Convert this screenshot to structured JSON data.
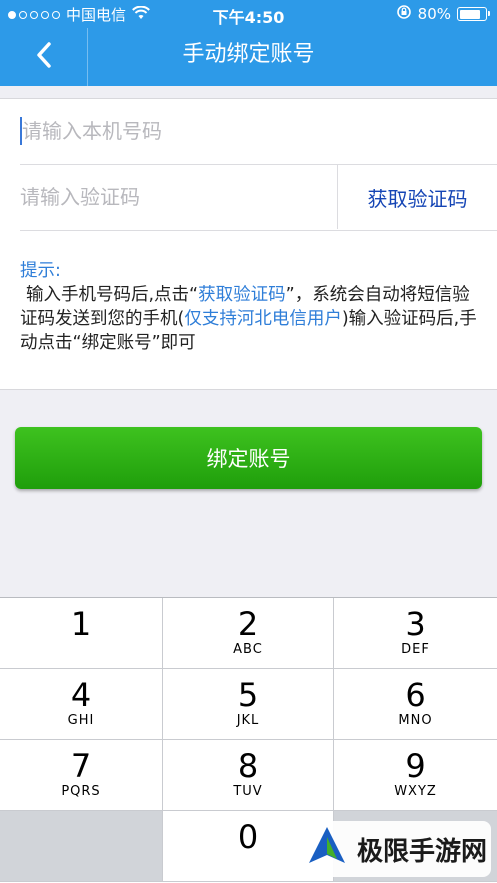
{
  "status_bar": {
    "carrier": "中国电信",
    "time": "下午4:50",
    "battery": "80%",
    "battery_level": 0.8,
    "signal_bars_filled": 1,
    "signal_bars_total": 5
  },
  "nav": {
    "back_icon": "chevron-left-icon",
    "title": "手动绑定账号"
  },
  "form": {
    "phone_placeholder": "请输入本机号码",
    "phone_value": "",
    "code_placeholder": "请输入验证码",
    "code_value": "",
    "get_code_label": "获取验证码"
  },
  "hint": {
    "label": "提示:",
    "part1": "输入手机号码后,点击“",
    "link1": "获取验证码",
    "part2": "”，系统会自动将短信验证码发送到您的手机(",
    "link2": "仅支持河北电信用户",
    "part3": ")输入验证码后,手动点击“绑定账号”即可"
  },
  "bind_button": {
    "label": "绑定账号"
  },
  "keypad": {
    "keys": [
      {
        "num": "1",
        "letters": ""
      },
      {
        "num": "2",
        "letters": "ABC"
      },
      {
        "num": "3",
        "letters": "DEF"
      },
      {
        "num": "4",
        "letters": "GHI"
      },
      {
        "num": "5",
        "letters": "JKL"
      },
      {
        "num": "6",
        "letters": "MNO"
      },
      {
        "num": "7",
        "letters": "PQRS"
      },
      {
        "num": "8",
        "letters": "TUV"
      },
      {
        "num": "9",
        "letters": "WXYZ"
      },
      {
        "num": "0",
        "letters": ""
      }
    ]
  },
  "watermark": {
    "text": "极限手游网"
  },
  "colors": {
    "nav_blue": "#2d9ae8",
    "link_blue": "#2f7ed8",
    "get_code_blue": "#1545b5",
    "button_green": "#2aae14"
  }
}
